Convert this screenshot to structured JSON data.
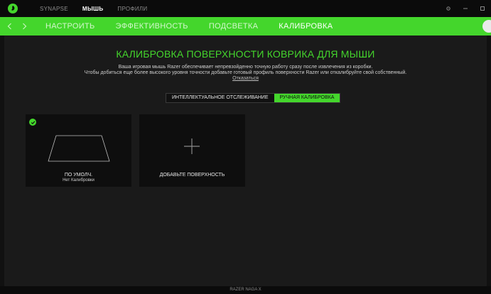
{
  "titlebar": {
    "tabs": [
      {
        "label": "SYNAPSE",
        "active": false
      },
      {
        "label": "МЫШЬ",
        "active": true
      },
      {
        "label": "ПРОФИЛИ",
        "active": false
      }
    ]
  },
  "subnav": {
    "tabs": [
      {
        "label": "НАСТРОИТЬ",
        "active": false
      },
      {
        "label": "ЭФФЕКТИВНОСТЬ",
        "active": false
      },
      {
        "label": "ПОДСВЕТКА",
        "active": false
      },
      {
        "label": "КАЛИБРОВКА",
        "active": true
      }
    ]
  },
  "main": {
    "title": "КАЛИБРОВКА ПОВЕРХНОСТИ КОВРИКА ДЛЯ МЫШИ",
    "description_line1": "Ваша игровая мышь Razer обеспечивает непревзойденно точную работу сразу после извлечения из коробки.",
    "description_line2": "Чтобы добиться еще более высокого уровня точности добавьте готовый профиль поверхности Razer или откалибруйте свой собственный.",
    "skip_link": "Отказаться",
    "toggle": {
      "smart_tracking": "ИНТЕЛЛЕКТУАЛЬНОЕ ОТСЛЕЖИВАНИЕ",
      "manual_calibration": "РУЧНАЯ КАЛИБРОВКА",
      "active": "manual_calibration"
    },
    "cards": {
      "default_name": "ПО УМОЛЧ.",
      "default_sub": "Нет Калибровки",
      "add_name": "ДОБАВЬТЕ ПОВЕРХНОСТЬ"
    }
  },
  "statusbar": {
    "device": "RAZER NAGA X"
  },
  "colors": {
    "accent": "#44d62c",
    "background": "#1a1a1a",
    "card": "#0e0e0e",
    "titlebar": "#0b0b0b"
  },
  "icons": {
    "logo": "razer-logo-icon",
    "back": "chevron-left-icon",
    "forward": "chevron-right-icon",
    "settings": "gear-icon",
    "minimize": "minimize-icon",
    "maximize": "maximize-icon",
    "check": "check-icon",
    "pad": "mousepad-icon",
    "add": "plus-icon"
  }
}
